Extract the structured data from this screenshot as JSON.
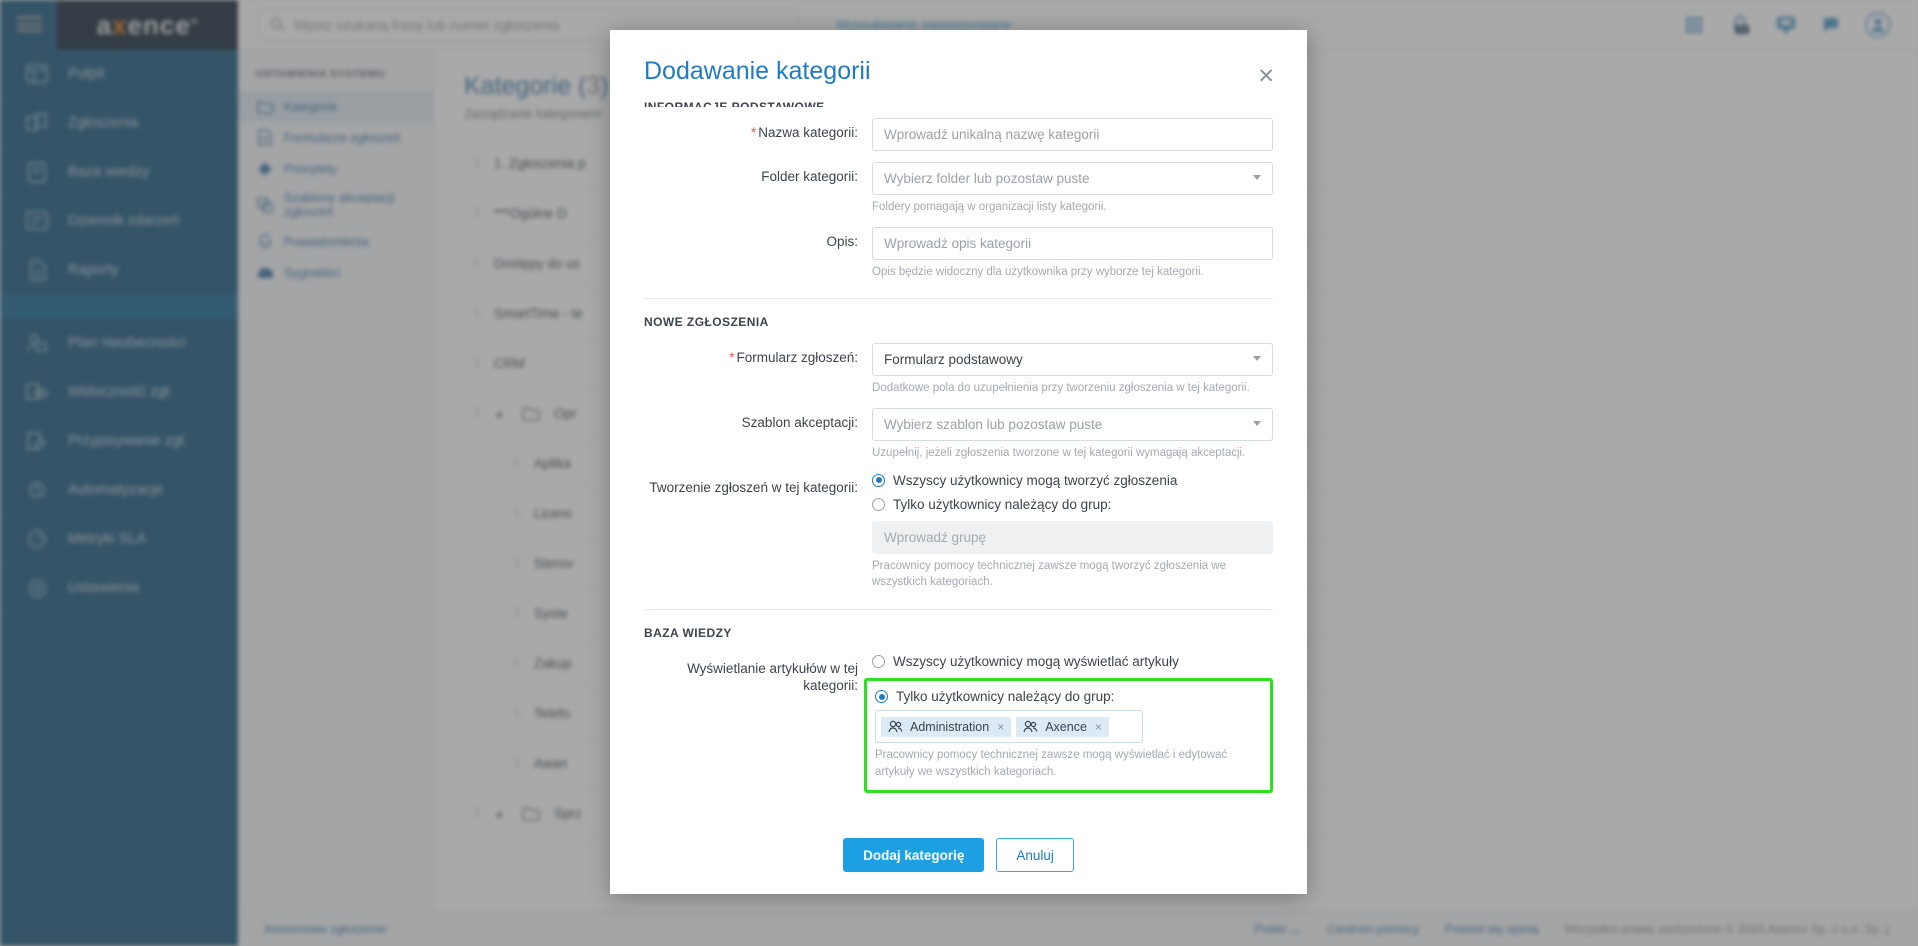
{
  "app": {
    "logo_text_pre": "a",
    "logo_text_x": "x",
    "logo_text_post": "ence",
    "logo_reg": "®"
  },
  "topbar": {
    "search_placeholder": "Wpisz szukaną frazę lub numer zgłoszenia",
    "advanced_search": "Wyszukiwanie zaawansowane"
  },
  "sidebar": {
    "items": [
      {
        "label": "Pulpit",
        "icon": "dashboard-icon"
      },
      {
        "label": "Zgłoszenia",
        "icon": "tickets-icon"
      },
      {
        "label": "Baza wiedzy",
        "icon": "knowledge-base-icon"
      },
      {
        "label": "Dziennik zdarzeń",
        "icon": "event-log-icon"
      },
      {
        "label": "Raporty",
        "icon": "reports-icon"
      }
    ],
    "items_lower": [
      {
        "label": "Plan nieobecności",
        "icon": "absence-plan-icon"
      },
      {
        "label": "Widoczność zgł.",
        "icon": "visibility-icon"
      },
      {
        "label": "Przypisywanie zgł.",
        "icon": "assignment-icon"
      },
      {
        "label": "Automatyzacje",
        "icon": "automation-icon"
      },
      {
        "label": "Metryki SLA",
        "icon": "sla-metrics-icon"
      },
      {
        "label": "Ustawienia",
        "icon": "settings-icon"
      }
    ]
  },
  "settings_panel": {
    "title": "USTAWIENIA SYSTEMU",
    "items": [
      {
        "label": "Kategorie",
        "icon": "folder-icon",
        "active": true
      },
      {
        "label": "Formularze zgłoszeń",
        "icon": "form-icon",
        "active": false
      },
      {
        "label": "Priorytety",
        "icon": "priority-icon",
        "active": false
      },
      {
        "label": "Szablony akceptacji zgłoszeń",
        "icon": "approval-template-icon",
        "active": false
      },
      {
        "label": "Powiadomienia",
        "icon": "bell-icon",
        "active": false
      },
      {
        "label": "Sygnaliści",
        "icon": "whistleblower-icon",
        "active": false
      }
    ]
  },
  "content": {
    "page_title": "Kategorie (",
    "page_title_count": "3",
    "page_subtitle": "Zarządzanie kategoriami",
    "rows": [
      {
        "label": "1. Zgłoszenia p",
        "type": "leaf",
        "indent": 0
      },
      {
        "label": "***Ogólne   D",
        "type": "leaf",
        "indent": 0
      },
      {
        "label": "Dostępy do us",
        "type": "leaf",
        "indent": 0
      },
      {
        "label": "SmartTime - te",
        "type": "leaf",
        "indent": 0
      },
      {
        "label": "CRM",
        "type": "leaf",
        "indent": 0
      },
      {
        "label": "Opr",
        "type": "folder",
        "indent": 0
      },
      {
        "label": "Aplika",
        "type": "leaf",
        "indent": 1
      },
      {
        "label": "Licenc",
        "type": "leaf",
        "indent": 1
      },
      {
        "label": "Sterov",
        "type": "leaf",
        "indent": 1
      },
      {
        "label": "Syste",
        "type": "leaf",
        "indent": 1
      },
      {
        "label": "Zakup",
        "type": "leaf",
        "indent": 1
      },
      {
        "label": "Telefo",
        "type": "leaf",
        "indent": 1
      },
      {
        "label": "Awari",
        "type": "leaf",
        "indent": 1
      },
      {
        "label": "Sprz",
        "type": "folder",
        "indent": 0
      }
    ]
  },
  "footer": {
    "anonymous_report": "Anonimowe zgłoszenie",
    "language": "Polski",
    "help_center": "Centrum pomocy",
    "share_opinion": "Podziel się opinią",
    "copyright": "Wszystkie prawa zastrzeżone © 2024 Axence Sp. z o.o. Sp. j."
  },
  "modal": {
    "title": "Dodawanie kategorii",
    "close_label": "✕",
    "section_basic": "INFORMACJE PODSTAWOWE",
    "name": {
      "label": "Nazwa kategorii:",
      "required": "*",
      "placeholder": "Wprowadź unikalną nazwę kategorii",
      "value": ""
    },
    "folder": {
      "label": "Folder kategorii:",
      "placeholder": "Wybierz folder lub pozostaw puste",
      "hint": "Foldery pomagają w organizacji listy kategorii."
    },
    "description": {
      "label": "Opis:",
      "placeholder": "Wprowadź opis kategorii",
      "value": "",
      "hint": "Opis będzie widoczny dla użytkownika przy wyborze tej kategorii."
    },
    "section_new_tickets": "NOWE ZGŁOSZENIA",
    "form": {
      "label": "Formularz zgłoszeń:",
      "required": "*",
      "value": "Formularz podstawowy",
      "hint": "Dodatkowe pola do uzupełnienia przy tworzeniu zgłoszenia w tej kategorii."
    },
    "approval_template": {
      "label": "Szablon akceptacji:",
      "placeholder": "Wybierz szablon lub pozostaw puste",
      "hint": "Uzupełnij, jeżeli zgłoszenia tworzone w tej kategorii wymagają akceptacji."
    },
    "ticket_creation": {
      "label": "Tworzenie zgłoszeń w tej kategorii:",
      "option_all": "Wszyscy użytkownicy mogą tworzyć zgłoszenia",
      "option_groups": "Tylko użytkownicy należący do grup:",
      "selected": "all",
      "group_placeholder": "Wprowadź grupę",
      "hint": "Pracownicy pomocy technicznej zawsze mogą tworzyć zgłoszenia we wszystkich kategoriach."
    },
    "section_knowledge_base": "BAZA WIEDZY",
    "article_visibility": {
      "label": "Wyświetlanie artykułów w tej kategorii:",
      "option_all": "Wszyscy użytkownicy mogą wyświetlać artykuły",
      "option_groups": "Tylko użytkownicy należący do grup:",
      "selected": "groups",
      "chips": [
        {
          "label": "Administration",
          "remove": "×"
        },
        {
          "label": "Axence",
          "remove": "×"
        }
      ],
      "hint": "Pracownicy pomocy technicznej zawsze mogą wyświetlać i edytować artykuły we wszystkich kategoriach.",
      "highlight_color": "#2ee01f"
    },
    "submit_label": "Dodaj kategorię",
    "cancel_label": "Anuluj"
  },
  "colors": {
    "accent": "#1ca0e3",
    "title_blue": "#1f7bc4",
    "sidebar_bg": "#0d4f77",
    "required_red": "#e8584f",
    "highlight_green": "#2ee01f"
  }
}
